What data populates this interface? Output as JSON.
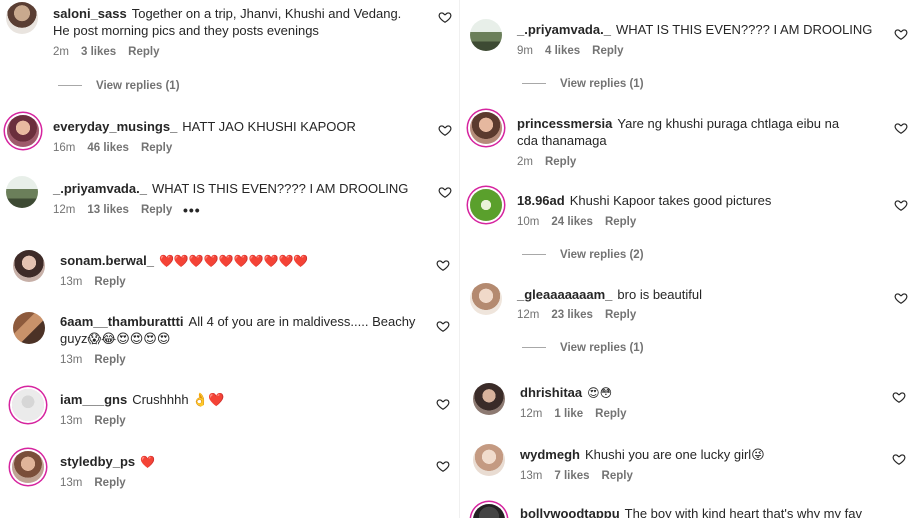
{
  "left": {
    "comments": [
      {
        "username": "saloni_sass",
        "text": "Together on a trip, Jhanvi, Khushi and Vedang. He post morning pics and they posts evenings",
        "time": "2m",
        "likes": "3 likes",
        "reply": "Reply",
        "view_replies": "View replies (1)"
      },
      {
        "username": "everyday_musings_",
        "text": "HATT JAO KHUSHI KAPOOR",
        "time": "16m",
        "likes": "46 likes",
        "reply": "Reply"
      },
      {
        "username": "_.priyamvada._",
        "text": "WHAT IS THIS EVEN???? I AM DROOLING",
        "time": "12m",
        "likes": "13 likes",
        "reply": "Reply",
        "more": "•••"
      },
      {
        "username": "sonam.berwal_",
        "text": "❤️❤️❤️❤️❤️❤️❤️❤️❤️❤️",
        "time": "13m",
        "reply": "Reply"
      },
      {
        "username": "6aam__thamburattti",
        "text": "All 4 of you are in maldivess..... Beachy guyz😱😂😍😍😍😍",
        "time": "13m",
        "reply": "Reply"
      },
      {
        "username": "iam___gns",
        "text": "Crushhhh 👌❤️",
        "time": "13m",
        "reply": "Reply"
      },
      {
        "username": "styledby_ps",
        "text": "❤️",
        "time": "13m",
        "reply": "Reply"
      }
    ]
  },
  "right": {
    "comments": [
      {
        "username": "_.priyamvada._",
        "text": "WHAT IS THIS EVEN???? I AM DROOLING",
        "time": "9m",
        "likes": "4 likes",
        "reply": "Reply",
        "view_replies": "View replies (1)"
      },
      {
        "username": "princessmersia",
        "text": "Yare ng khushi puraga chtlaga eibu na cda thanamaga",
        "time": "2m",
        "reply": "Reply"
      },
      {
        "username": "18.96ad",
        "text": "Khushi Kapoor takes good pictures",
        "time": "10m",
        "likes": "24 likes",
        "reply": "Reply",
        "view_replies": "View replies (2)"
      },
      {
        "username": "_gleaaaaaaam_",
        "text": "bro is beautiful",
        "time": "12m",
        "likes": "23 likes",
        "reply": "Reply",
        "view_replies": "View replies (1)"
      },
      {
        "username": "dhrishitaa",
        "text": "😍😳",
        "time": "12m",
        "likes": "1 like",
        "reply": "Reply"
      },
      {
        "username": "wydmegh",
        "text": "Khushi you are one lucky girl😜",
        "time": "13m",
        "likes": "7 likes",
        "reply": "Reply"
      },
      {
        "username": "bollywoodtappu",
        "text": "The boy with kind heart that's why my fav"
      }
    ]
  },
  "colors": {
    "text": "#262626",
    "meta": "#737373",
    "heart_emoji": "#e0245e",
    "story_ring": "#d6249f"
  },
  "icons": {
    "like": "heart-outline-icon",
    "more": "more-horizontal-icon"
  }
}
